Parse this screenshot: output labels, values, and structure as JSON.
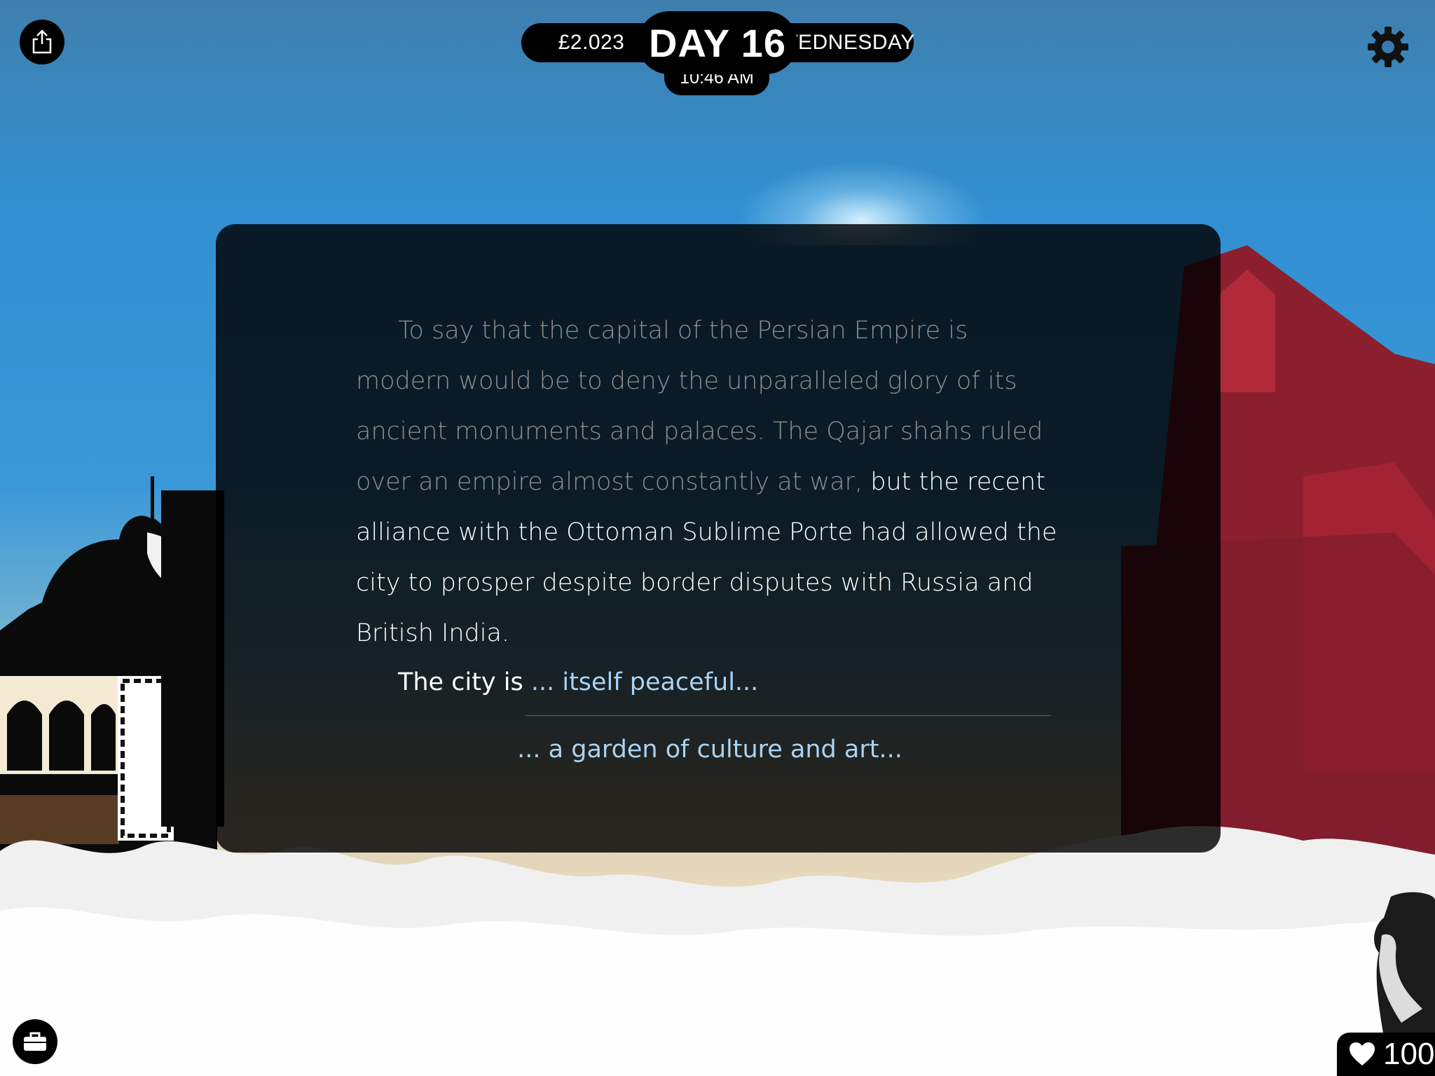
{
  "hud": {
    "money": "£2.023",
    "day": "DAY 16",
    "time": "10:46 AM",
    "weekday": "WEDNESDAY"
  },
  "story": {
    "faded_text": "To say that the capital of the Persian Empire is modern would be to deny the unparalleled glory of its ancient monuments and palaces. The Qajar shahs ruled over an empire almost constantly at war, ",
    "bright_text": "but the recent alliance with the Ottoman Sublime Porte had allowed the city to prosper despite border disputes with Russia and British India.",
    "choice_prompt": "The city is ",
    "choices": [
      "... itself peaceful...",
      "... a garden of culture and art..."
    ]
  },
  "status": {
    "health": "100"
  },
  "icons": {
    "share": "share-icon",
    "settings": "gear-icon",
    "inventory": "briefcase-icon",
    "health": "heart-icon"
  },
  "colors": {
    "choice": "#a9d3f3",
    "panel": "#000000",
    "sky": "#3190d2"
  }
}
